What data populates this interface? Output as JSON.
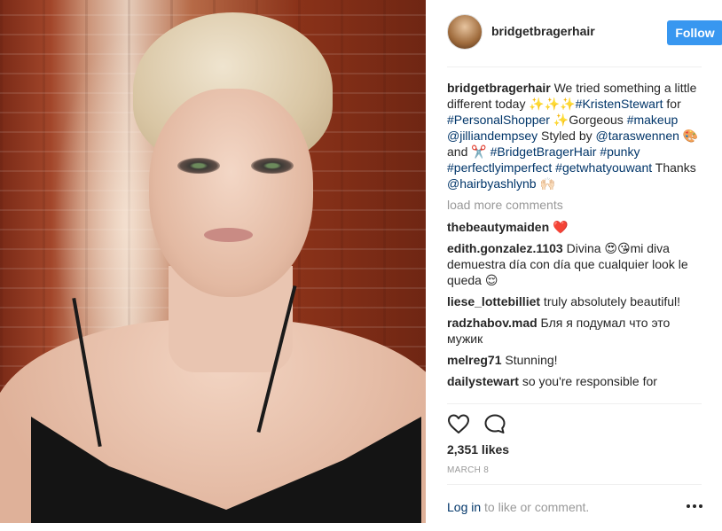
{
  "post": {
    "username": "bridgetbragerhair",
    "follow_label": "Follow",
    "caption": {
      "author": "bridgetbragerhair",
      "t1": " We tried something a little different today ",
      "e1": "✨✨✨",
      "tag1": "#KristenStewart",
      "t2": " for ",
      "tag2": "#PersonalShopper",
      "e2": " ✨",
      "t3": "Gorgeous ",
      "tag3": "#makeup",
      "t4": " ",
      "tag4": "@jilliandempsey",
      "t5": " Styled by ",
      "tag5": "@taraswennen",
      "e3": " 🎨",
      "t6": "and ",
      "e4": "✂️",
      "t7": " ",
      "tag6": "#BridgetBragerHair",
      "t8": " ",
      "tag7": "#punky",
      "t9": " ",
      "tag8": "#perfectlyimperfect",
      "t10": " ",
      "tag9": "#getwhatyouwant",
      "t11": " Thanks ",
      "tag10": "@hairbyashlynb",
      "e5": " 🙌🏻"
    },
    "load_more": "load more comments",
    "comments": [
      {
        "author": "thebeautymaiden",
        "text": " ❤️"
      },
      {
        "author": "edith.gonzalez.1103",
        "text": " Divina 😍😘mi diva demuestra día con día que cualquier look le queda 😌"
      },
      {
        "author": "liese_lottebilliet",
        "text": " truly absolutely beautiful!"
      },
      {
        "author": "radzhabov.mad",
        "text": " Бля я подумал что это мужик"
      },
      {
        "author": "melreg71",
        "text": " Stunning!"
      },
      {
        "author": "dailystewart",
        "text": " so you're responsible for"
      }
    ],
    "likes": "2,351 likes",
    "date": "MARCH 8",
    "footer": {
      "login": "Log in",
      "rest": " to like or comment."
    },
    "icons": {
      "like": "heart-icon",
      "comment": "comment-icon",
      "more": "more-options-icon"
    },
    "colors": {
      "follow_button": "#3897f0",
      "link": "#003569",
      "muted": "#999999"
    }
  }
}
